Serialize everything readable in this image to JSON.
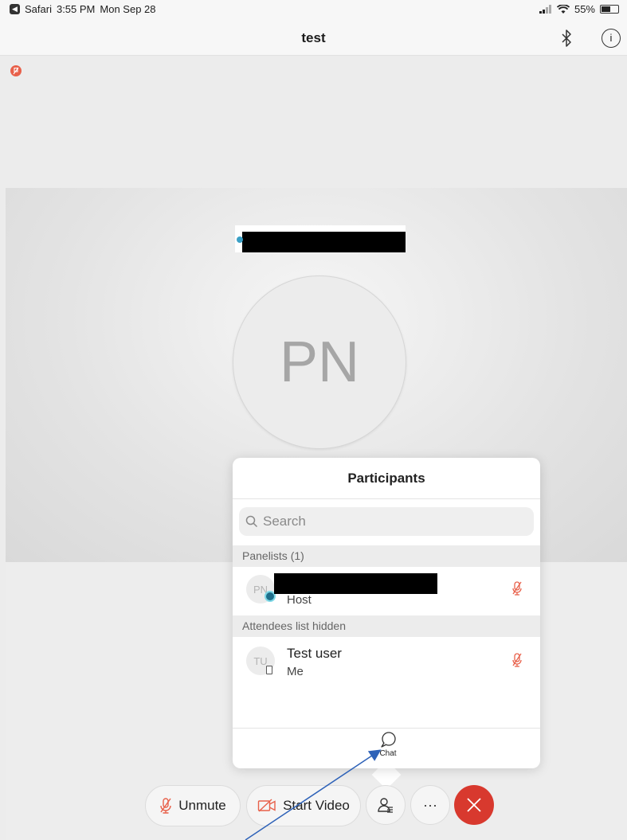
{
  "status_bar": {
    "back_app": "Safari",
    "time": "3:55 PM",
    "date": "Mon Sep 28",
    "battery": "55%",
    "battery_level": 0.55
  },
  "nav": {
    "title": "test",
    "bluetooth_icon": "bluetooth-icon",
    "info_icon": "info-icon",
    "info_glyph": "i"
  },
  "stage": {
    "avatar_initials": "PN"
  },
  "participants": {
    "title": "Participants",
    "search_placeholder": "Search",
    "panelists_header": "Panelists (1)",
    "panelists": [
      {
        "initials": "PN",
        "role": "Host",
        "muted": true
      }
    ],
    "attendees_header": "Attendees list hidden",
    "attendees": [
      {
        "initials": "TU",
        "name": "Test user",
        "sub": "Me",
        "muted": true
      }
    ],
    "chat_label": "Chat"
  },
  "toolbar": {
    "unmute_label": "Unmute",
    "start_video_label": "Start Video",
    "more_label": "···"
  },
  "colors": {
    "mute_red": "#e8604a",
    "end_red": "#d8392e",
    "arrow_blue": "#2e62b8"
  }
}
